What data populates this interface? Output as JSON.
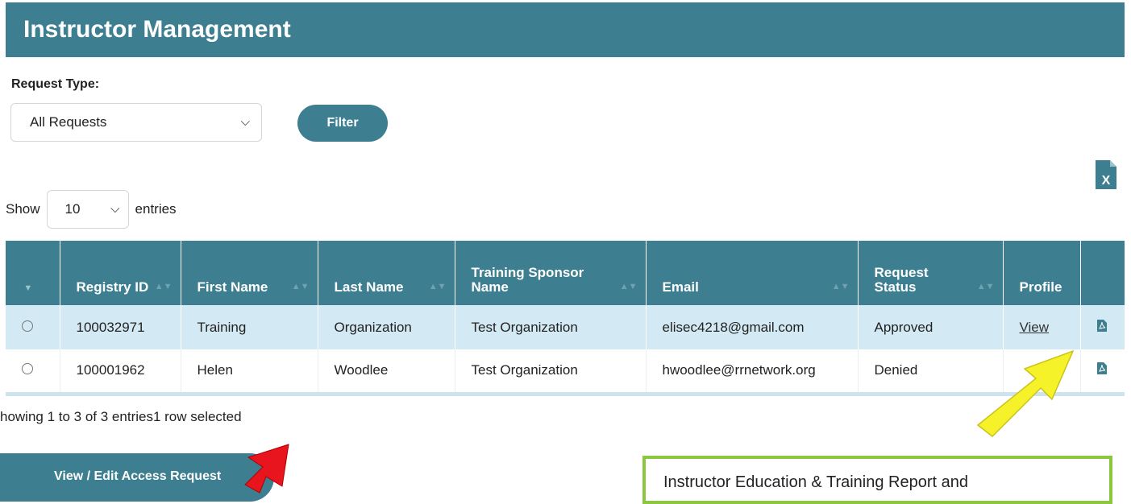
{
  "header": {
    "title": "Instructor Management"
  },
  "filter": {
    "request_type_label": "Request Type:",
    "request_type_value": "All Requests",
    "filter_button": "Filter"
  },
  "length": {
    "show_label": "Show",
    "value": "10",
    "entries_label": "entries"
  },
  "table": {
    "columns": [
      "Registry ID",
      "First Name",
      "Last Name",
      "Training Sponsor Name",
      "Email",
      "Request Status",
      "Profile"
    ],
    "rows": [
      {
        "registry_id": "100032971",
        "first_name": "Training",
        "last_name": "Organization",
        "sponsor": "Test Organization",
        "email": "elisec4218@gmail.com",
        "status": "Approved",
        "profile": "View"
      },
      {
        "registry_id": "100001962",
        "first_name": "Helen",
        "last_name": "Woodlee",
        "sponsor": "Test Organization",
        "email": "hwoodlee@rrnetwork.org",
        "status": "Denied",
        "profile": ""
      }
    ]
  },
  "footer": {
    "showing": "howing 1 to 3 of 3 entries1 row selected"
  },
  "actions": {
    "edit_button": "View / Edit Access Request"
  },
  "annotation": {
    "note": "Instructor Education & Training Report and"
  },
  "colors": {
    "accent": "#3d7f90",
    "selected_row": "#d3e9f4",
    "note_border": "#8dc63f",
    "red_arrow": "#e8141e",
    "yellow_arrow": "#f5f22a"
  },
  "icons": {
    "excel": "excel-export-icon",
    "pdf": "pdf-icon",
    "chevron": "chevron-down-icon"
  }
}
